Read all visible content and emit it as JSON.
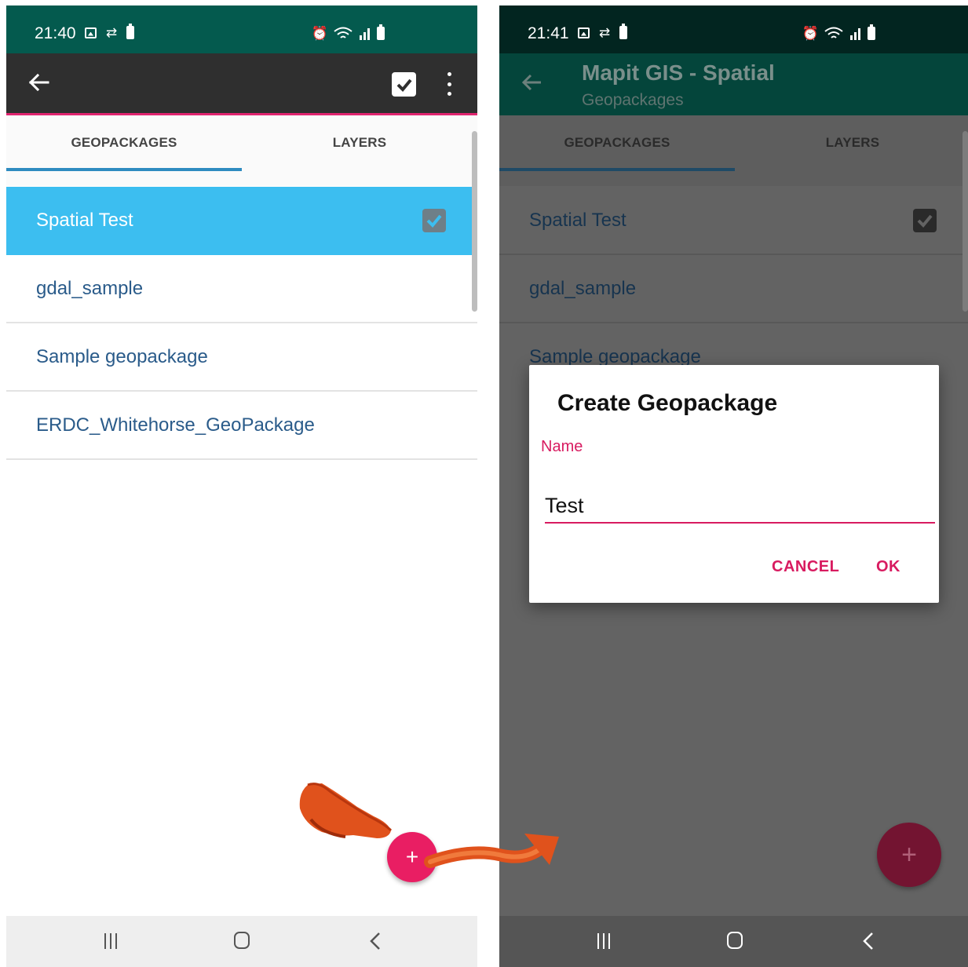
{
  "left_screen": {
    "status": {
      "time": "21:40"
    },
    "tabs": [
      {
        "label": "GEOPACKAGES"
      },
      {
        "label": "LAYERS"
      }
    ],
    "items": [
      {
        "label": "Spatial Test",
        "checked": true
      },
      {
        "label": "gdal_sample"
      },
      {
        "label": "Sample geopackage"
      },
      {
        "label": "ERDC_Whitehorse_GeoPackage"
      }
    ],
    "fab": "+"
  },
  "right_screen": {
    "status": {
      "time": "21:41"
    },
    "app_title": "Mapit GIS - Spatial",
    "app_subtitle": "Geopackages",
    "tabs": [
      {
        "label": "GEOPACKAGES"
      },
      {
        "label": "LAYERS"
      }
    ],
    "items": [
      {
        "label": "Spatial Test",
        "checked": true
      },
      {
        "label": "gdal_sample"
      },
      {
        "label": "Sample geopackage"
      }
    ],
    "dialog": {
      "title": "Create Geopackage",
      "field_label": "Name",
      "field_value": "Test",
      "cancel": "CANCEL",
      "ok": "OK"
    },
    "fab": "+"
  },
  "colors": {
    "accent": "#E91E63",
    "selected_row": "#3CBEF0",
    "status_bar": "#045A4E",
    "toolbar": "#2F2F2F",
    "tab_indicator": "#2E8BC0"
  }
}
